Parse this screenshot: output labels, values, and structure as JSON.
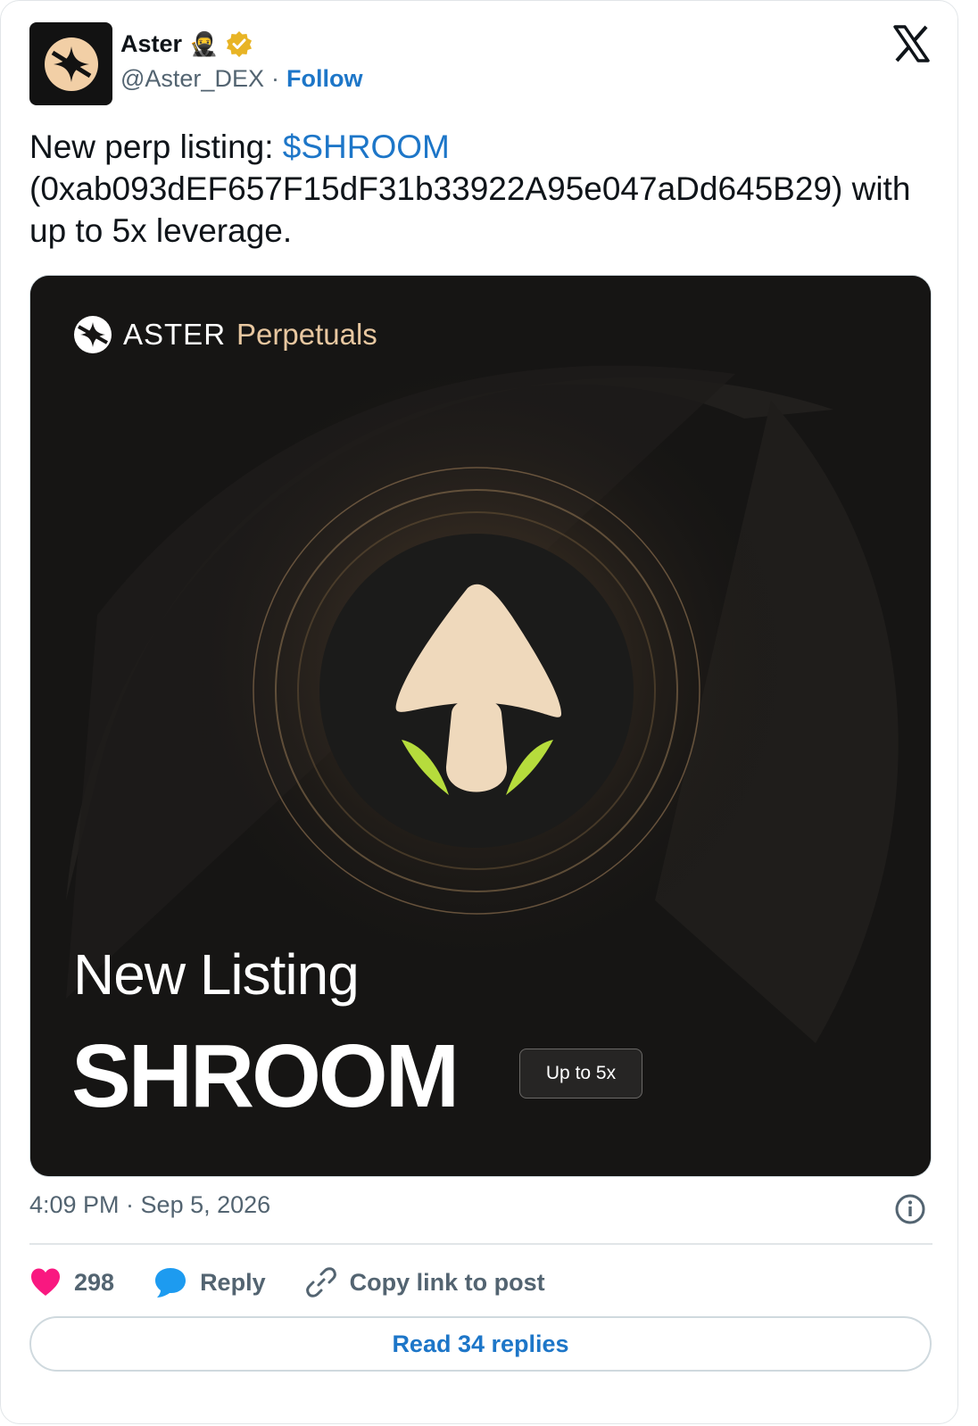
{
  "author": {
    "name": "Aster",
    "emoji": "🥷",
    "handle": "@Aster_DEX",
    "separator": "·",
    "follow_label": "Follow",
    "avatar_icon": "aster-logo-icon",
    "verified_icon": "verified-badge-icon"
  },
  "platform_icon": "x-logo-icon",
  "tweet": {
    "text_prefix": "New perp listing: ",
    "cashtag": "$SHROOM",
    "text_suffix": "(0xab093dEF657F15dF31b33922A95e047aDd645B29) with up to 5x leverage."
  },
  "media": {
    "brand_name": "ASTER",
    "brand_product": "Perpetuals",
    "headline": "New Listing",
    "ticker": "SHROOM",
    "leverage_pill": "Up to 5x",
    "token_icon": "mushroom-icon",
    "colors": {
      "accent": "#e8c7a0",
      "leaf": "#b6dc3c",
      "background": "#161514"
    }
  },
  "meta": {
    "timestamp": "4:09 PM · Sep 5, 2026",
    "info_icon": "info-icon"
  },
  "actions": {
    "likes_count": "298",
    "reply_label": "Reply",
    "copy_link_label": "Copy link to post"
  },
  "read_replies_label": "Read 34 replies",
  "colors": {
    "link": "#1d76c8",
    "like": "#f91880",
    "reply": "#1d9bf0",
    "muted": "#536471"
  }
}
